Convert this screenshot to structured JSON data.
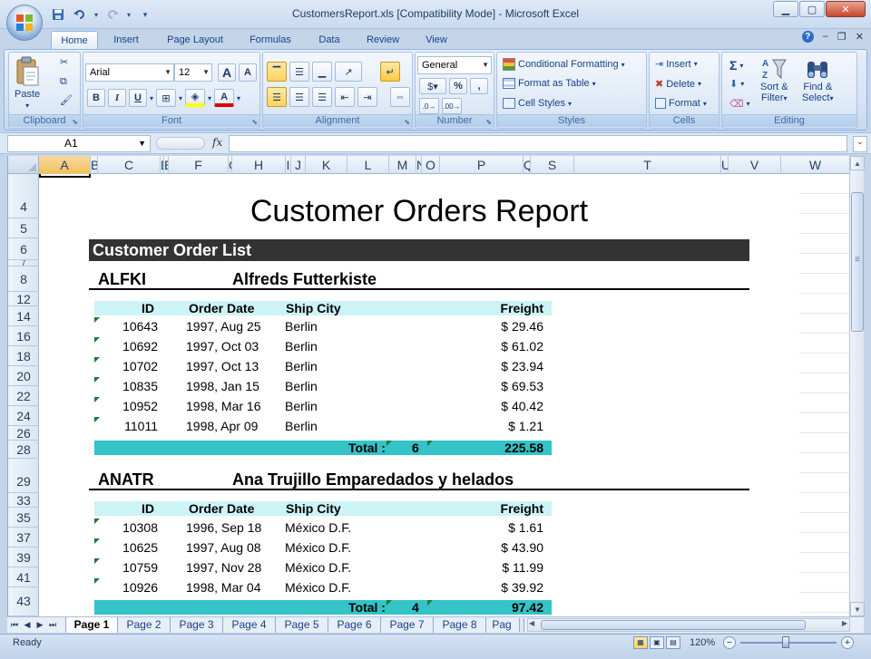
{
  "window": {
    "title": "CustomersReport.xls  [Compatibility Mode] - Microsoft Excel",
    "minimize_icon": "minimize-icon",
    "maximize_icon": "maximize-icon",
    "close_icon": "close-icon"
  },
  "qat": {
    "save_icon": "save-icon",
    "undo_icon": "undo-icon",
    "redo_icon": "redo-icon",
    "customize_icon": "chevron-down-icon"
  },
  "tabs": [
    "Home",
    "Insert",
    "Page Layout",
    "Formulas",
    "Data",
    "Review",
    "View"
  ],
  "active_tab": "Home",
  "ribbon": {
    "clipboard": {
      "label": "Clipboard",
      "paste": "Paste"
    },
    "font": {
      "label": "Font",
      "font_name": "Arial",
      "font_size": "12",
      "bold": "B",
      "italic": "I",
      "underline": "U",
      "grow": "A",
      "shrink": "A"
    },
    "alignment": {
      "label": "Alignment"
    },
    "number": {
      "label": "Number",
      "format": "General",
      "percent": "%",
      "comma": ","
    },
    "styles": {
      "label": "Styles",
      "conditional": "Conditional Formatting",
      "format_table": "Format as Table",
      "cell_styles": "Cell Styles"
    },
    "cells": {
      "label": "Cells",
      "insert": "Insert",
      "delete": "Delete",
      "format": "Format"
    },
    "editing": {
      "label": "Editing",
      "sort_filter_1": "Sort &",
      "sort_filter_2": "Filter",
      "find_select_1": "Find &",
      "find_select_2": "Select",
      "sigma": "Σ"
    }
  },
  "formula_bar": {
    "name_box": "A1",
    "fx": "fx",
    "formula": ""
  },
  "columns": [
    "A",
    "B",
    "C",
    "D",
    "E",
    "F",
    "G",
    "H",
    "I",
    "J",
    "K",
    "L",
    "M",
    "N",
    "O",
    "P",
    "Q",
    "S",
    "T",
    "U",
    "V",
    "W"
  ],
  "rows": [
    "4",
    "5",
    "6",
    "7",
    "8",
    "12",
    "14",
    "16",
    "18",
    "20",
    "22",
    "24",
    "26",
    "28",
    "29",
    "33",
    "35",
    "37",
    "39",
    "41",
    "43"
  ],
  "report": {
    "title": "Customer Orders Report",
    "list_title": "Customer Order List",
    "col_headers": {
      "id": "ID",
      "date": "Order Date",
      "city": "Ship City",
      "freight": "Freight"
    },
    "total_label": "Total :",
    "customers": [
      {
        "id": "ALFKI",
        "name": "Alfreds Futterkiste",
        "orders": [
          {
            "id": "10643",
            "date": "1997, Aug 25",
            "city": "Berlin",
            "freight": "$ 29.46"
          },
          {
            "id": "10692",
            "date": "1997, Oct 03",
            "city": "Berlin",
            "freight": "$ 61.02"
          },
          {
            "id": "10702",
            "date": "1997, Oct 13",
            "city": "Berlin",
            "freight": "$ 23.94"
          },
          {
            "id": "10835",
            "date": "1998, Jan 15",
            "city": "Berlin",
            "freight": "$ 69.53"
          },
          {
            "id": "10952",
            "date": "1998, Mar 16",
            "city": "Berlin",
            "freight": "$ 40.42"
          },
          {
            "id": "11011",
            "date": "1998, Apr 09",
            "city": "Berlin",
            "freight": "$ 1.21"
          }
        ],
        "total_count": "6",
        "total_freight": "225.58"
      },
      {
        "id": "ANATR",
        "name": "Ana Trujillo Emparedados y helados",
        "orders": [
          {
            "id": "10308",
            "date": "1996, Sep 18",
            "city": "México D.F.",
            "freight": "$ 1.61"
          },
          {
            "id": "10625",
            "date": "1997, Aug 08",
            "city": "México D.F.",
            "freight": "$ 43.90"
          },
          {
            "id": "10759",
            "date": "1997, Nov 28",
            "city": "México D.F.",
            "freight": "$ 11.99"
          },
          {
            "id": "10926",
            "date": "1998, Mar 04",
            "city": "México D.F.",
            "freight": "$ 39.92"
          }
        ],
        "total_count": "4",
        "total_freight": "97.42"
      }
    ]
  },
  "sheet_tabs": [
    "Page 1",
    "Page 2",
    "Page 3",
    "Page 4",
    "Page 5",
    "Page 6",
    "Page 7",
    "Page 8",
    "Pag"
  ],
  "active_sheet": "Page 1",
  "status": {
    "text": "Ready",
    "zoom": "120%",
    "zoom_out": "−",
    "zoom_in": "+"
  }
}
